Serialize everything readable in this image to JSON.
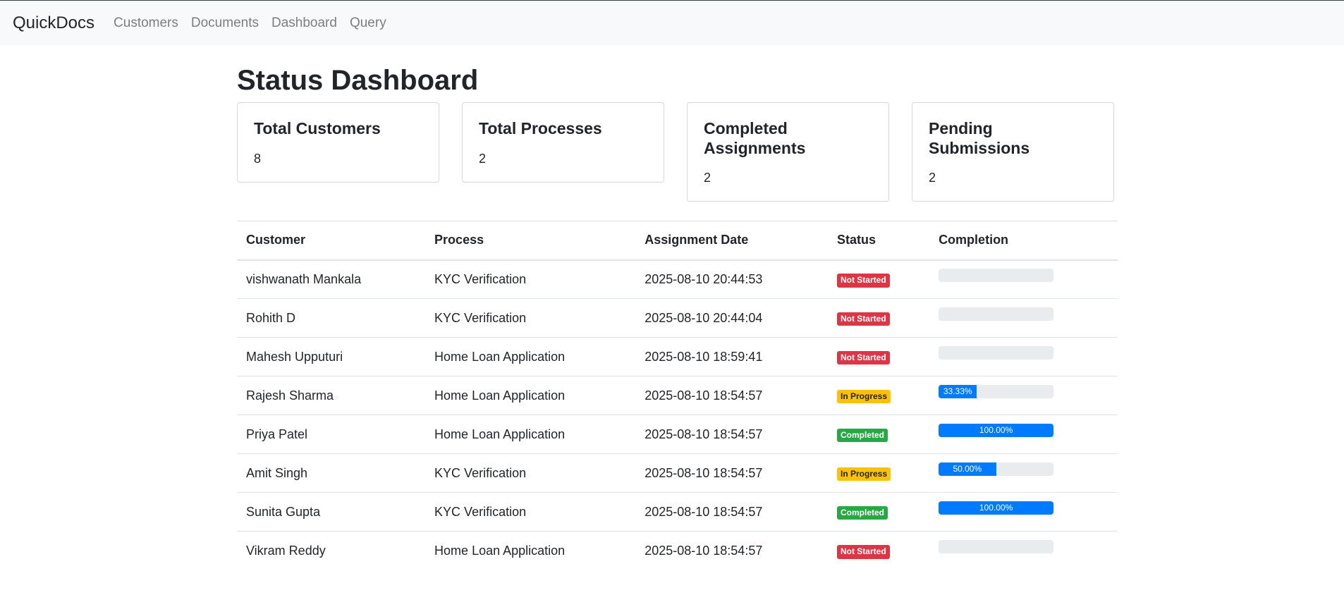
{
  "navbar": {
    "brand": "QuickDocs",
    "links": [
      "Customers",
      "Documents",
      "Dashboard",
      "Query"
    ]
  },
  "page": {
    "title": "Status Dashboard"
  },
  "cards": [
    {
      "title": "Total Customers",
      "value": "8"
    },
    {
      "title": "Total Processes",
      "value": "2"
    },
    {
      "title": "Completed Assignments",
      "value": "2"
    },
    {
      "title": "Pending Submissions",
      "value": "2"
    }
  ],
  "table": {
    "headers": [
      "Customer",
      "Process",
      "Assignment Date",
      "Status",
      "Completion"
    ],
    "rows": [
      {
        "customer": "vishwanath Mankala",
        "process": "KYC Verification",
        "date": "2025-08-10 20:44:53",
        "status": "Not Started",
        "status_color": "#dc3545",
        "completion": 0,
        "completion_label": ""
      },
      {
        "customer": "Rohith D",
        "process": "KYC Verification",
        "date": "2025-08-10 20:44:04",
        "status": "Not Started",
        "status_color": "#dc3545",
        "completion": 0,
        "completion_label": ""
      },
      {
        "customer": "Mahesh Upputuri",
        "process": "Home Loan Application",
        "date": "2025-08-10 18:59:41",
        "status": "Not Started",
        "status_color": "#dc3545",
        "completion": 0,
        "completion_label": ""
      },
      {
        "customer": "Rajesh Sharma",
        "process": "Home Loan Application",
        "date": "2025-08-10 18:54:57",
        "status": "In Progress",
        "status_color": "#ffc107",
        "completion": 33.33,
        "completion_label": "33.33%"
      },
      {
        "customer": "Priya Patel",
        "process": "Home Loan Application",
        "date": "2025-08-10 18:54:57",
        "status": "Completed",
        "status_color": "#28a745",
        "completion": 100,
        "completion_label": "100.00%"
      },
      {
        "customer": "Amit Singh",
        "process": "KYC Verification",
        "date": "2025-08-10 18:54:57",
        "status": "In Progress",
        "status_color": "#ffc107",
        "completion": 50,
        "completion_label": "50.00%"
      },
      {
        "customer": "Sunita Gupta",
        "process": "KYC Verification",
        "date": "2025-08-10 18:54:57",
        "status": "Completed",
        "status_color": "#28a745",
        "completion": 100,
        "completion_label": "100.00%"
      },
      {
        "customer": "Vikram Reddy",
        "process": "Home Loan Application",
        "date": "2025-08-10 18:54:57",
        "status": "Not Started",
        "status_color": "#dc3545",
        "completion": 0,
        "completion_label": ""
      }
    ]
  },
  "colors": {
    "progress_fill": "#007bff",
    "progress_track": "#e9ecef",
    "navbar_bg": "#f8f9fa"
  }
}
